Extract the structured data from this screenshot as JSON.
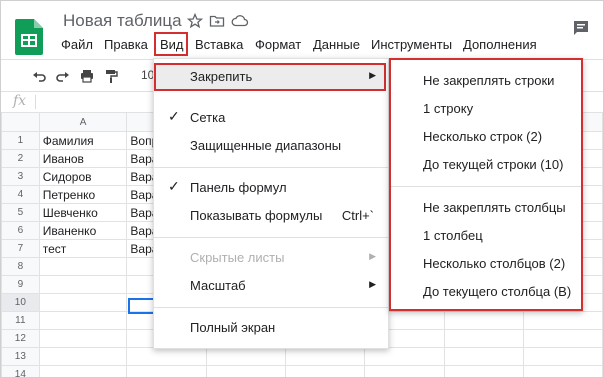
{
  "app": {
    "doc_title": "Новая таблица",
    "brand_color": "#0f9d58",
    "title_icons": [
      "star-icon",
      "move-to-folder-icon",
      "cloud-status-icon"
    ]
  },
  "menubar": {
    "items": [
      "Файл",
      "Правка",
      "Вид",
      "Вставка",
      "Формат",
      "Данные",
      "Инструменты",
      "Дополнения"
    ],
    "active": "Вид"
  },
  "toolbar": {
    "icons": [
      "undo-icon",
      "redo-icon",
      "print-icon",
      "paint-format-icon"
    ],
    "zoom_label": "10"
  },
  "formula_bar": {
    "fx_label": "fx",
    "value": ""
  },
  "sheet": {
    "column_headers": [
      "A",
      ""
    ],
    "rows": [
      {
        "num": "1",
        "a": "Фамилия",
        "b": "Вопр"
      },
      {
        "num": "2",
        "a": "Иванов",
        "b": "Вара"
      },
      {
        "num": "3",
        "a": "Сидоров",
        "b": "Вара"
      },
      {
        "num": "4",
        "a": "Петренко",
        "b": "Вара"
      },
      {
        "num": "5",
        "a": "Шевченко",
        "b": "Вара"
      },
      {
        "num": "6",
        "a": "Иваненко",
        "b": "Вара"
      },
      {
        "num": "7",
        "a": "тест",
        "b": "Вара"
      },
      {
        "num": "8",
        "a": "",
        "b": ""
      },
      {
        "num": "9",
        "a": "",
        "b": ""
      },
      {
        "num": "10",
        "a": "",
        "b": ""
      },
      {
        "num": "11",
        "a": "",
        "b": ""
      },
      {
        "num": "12",
        "a": "",
        "b": ""
      },
      {
        "num": "13",
        "a": "",
        "b": ""
      },
      {
        "num": "14",
        "a": "",
        "b": ""
      }
    ]
  },
  "view_menu": {
    "items": [
      {
        "label": "Закрепить",
        "submenu": true,
        "highlighted": true
      },
      {
        "label": "Сетка",
        "checked": true
      },
      {
        "label": "Защищенные диапазоны"
      },
      {
        "label": "Панель формул",
        "checked": true
      },
      {
        "label": "Показывать формулы",
        "shortcut": "Ctrl+`"
      },
      {
        "label": "Скрытые листы",
        "submenu": true,
        "disabled": true
      },
      {
        "label": "Масштаб",
        "submenu": true
      },
      {
        "label": "Полный экран"
      }
    ]
  },
  "freeze_submenu": {
    "items": [
      "Не закреплять строки",
      "1 строку",
      "Несколько строк (2)",
      "До текущей строки (10)",
      "Не закреплять столбцы",
      "1 столбец",
      "Несколько столбцов (2)",
      "До текущего столбца (B)"
    ]
  },
  "colors": {
    "highlight_border": "#d32f2f",
    "selection": "#1a73e8"
  }
}
